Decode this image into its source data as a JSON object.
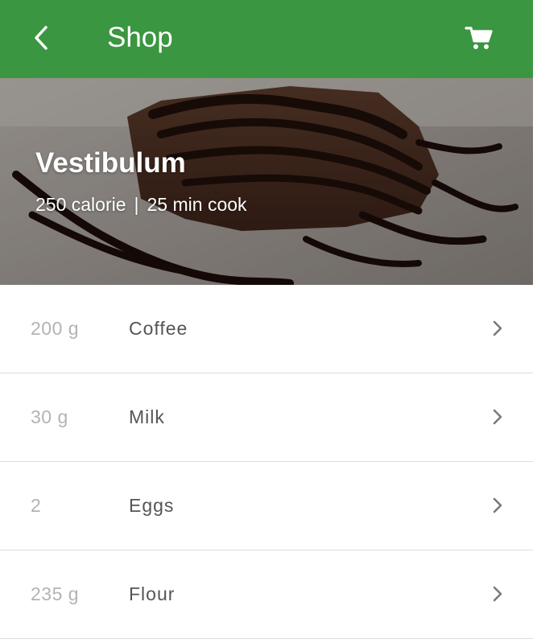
{
  "header": {
    "title": "Shop",
    "back_icon": "chevron-left-icon",
    "cart_icon": "cart-icon",
    "color": "#3a9640"
  },
  "hero": {
    "title": "Vestibulum",
    "calories": "250 calorie",
    "separator": "|",
    "cook_time": "25 min cook"
  },
  "ingredients": [
    {
      "qty": "200 g",
      "name": "Coffee"
    },
    {
      "qty": "30 g",
      "name": "Milk"
    },
    {
      "qty": "2",
      "name": "Eggs"
    },
    {
      "qty": "235 g",
      "name": "Flour"
    }
  ]
}
